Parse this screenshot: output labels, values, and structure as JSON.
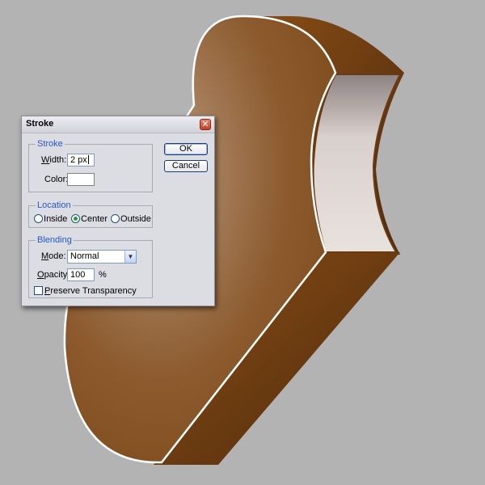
{
  "dialog": {
    "title": "Stroke",
    "close_glyph": "✕",
    "stroke_group": {
      "title": "Stroke",
      "width_label_underlined": "W",
      "width_label_rest": "idth:",
      "width_value": "2 px",
      "color_label": "Color:",
      "color_value": "#ffffff"
    },
    "location_group": {
      "title": "Location",
      "options": [
        {
          "label_underlined": "I",
          "label_rest": "nside",
          "selected": false
        },
        {
          "label_underlined": "C",
          "label_rest": "enter",
          "selected": true
        },
        {
          "label_underlined": "O",
          "label_rest": "utside",
          "selected": false
        }
      ]
    },
    "blending_group": {
      "title": "Blending",
      "mode_label_underlined": "M",
      "mode_label_rest": "ode:",
      "mode_value": "Normal",
      "opacity_label_underlined": "O",
      "opacity_label_rest": "pacity:",
      "opacity_value": "100",
      "opacity_unit": "%",
      "preserve_label_underlined": "P",
      "preserve_label_rest": "reserve Transparency",
      "preserve_checked": false
    },
    "ok_label": "OK",
    "cancel_label": "Cancel"
  },
  "colors": {
    "canvas_background": "#b3b3b3",
    "shape_face_light": "#b89a7e",
    "shape_face_dark": "#7a4714",
    "shape_side": "#6b3a12",
    "dialog_group_title": "#2457c5"
  },
  "icons": {
    "close": "close-icon",
    "dropdown": "chevron-down-icon"
  }
}
